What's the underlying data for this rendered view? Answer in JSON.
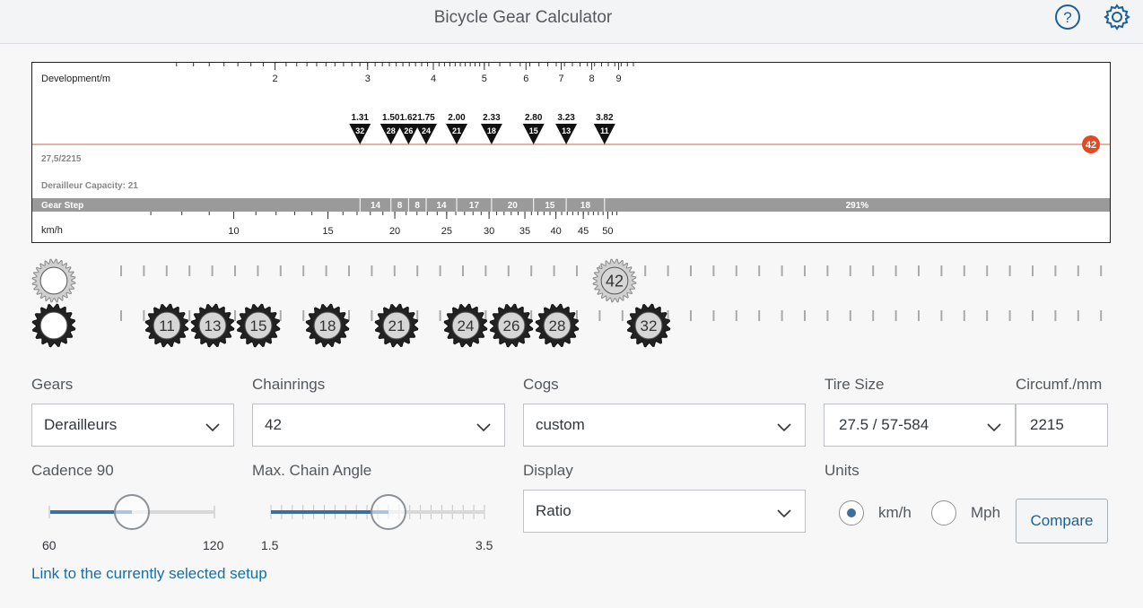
{
  "header": {
    "title": "Bicycle Gear Calculator",
    "help_icon": "help-circle-icon",
    "settings_icon": "gear-icon"
  },
  "chart_data": {
    "type": "gear-development-chart",
    "top_axis": {
      "label": "Development/m",
      "ticks": [
        "2",
        "3",
        "4",
        "5",
        "6",
        "7",
        "8",
        "9"
      ]
    },
    "bottom_axis": {
      "label": "km/h",
      "ticks": [
        "10",
        "15",
        "20",
        "25",
        "30",
        "35",
        "40",
        "45",
        "50"
      ]
    },
    "chainring_marker": "42",
    "setup_label": "27,5/2215",
    "capacity_label": "Derailleur Capacity: 21",
    "gear_step_label": "Gear Step",
    "ratios": [
      {
        "ratio": "1.31",
        "cog": "32"
      },
      {
        "ratio": "1.50",
        "cog": "28"
      },
      {
        "ratio": "1.62",
        "cog": "26"
      },
      {
        "ratio": "1.75",
        "cog": "24"
      },
      {
        "ratio": "2.00",
        "cog": "21"
      },
      {
        "ratio": "2.33",
        "cog": "18"
      },
      {
        "ratio": "2.80",
        "cog": "15"
      },
      {
        "ratio": "3.23",
        "cog": "13"
      },
      {
        "ratio": "3.82",
        "cog": "11"
      }
    ],
    "steps": [
      "14",
      "8",
      "8",
      "14",
      "17",
      "20",
      "15",
      "18",
      "291%"
    ],
    "colors": {
      "chainline": "#c8643c",
      "marker": "#e04a24",
      "stepbar": "#9a9a9a"
    }
  },
  "drivetrain": {
    "chainring": "42",
    "cogs": [
      "11",
      "13",
      "15",
      "18",
      "21",
      "24",
      "26",
      "28",
      "32"
    ]
  },
  "form": {
    "gears": {
      "label": "Gears",
      "value": "Derailleurs"
    },
    "chainrings": {
      "label": "Chainrings",
      "value": "42"
    },
    "cogs": {
      "label": "Cogs",
      "value": "custom"
    },
    "tire": {
      "label": "Tire Size",
      "value": "27.5 / 57-584"
    },
    "circ": {
      "label": "Circumf./mm",
      "value": "2215"
    },
    "cadence": {
      "label": "Cadence 90",
      "min": "60",
      "max": "120",
      "value": 90
    },
    "chain_angle": {
      "label": "Max. Chain Angle",
      "min": "1.5",
      "max": "3.5",
      "value": 2.5
    },
    "display": {
      "label": "Display",
      "value": "Ratio"
    },
    "units": {
      "label": "Units",
      "kmh": "km/h",
      "mph": "Mph",
      "selected": "km/h"
    },
    "compare_label": "Compare",
    "link_label": "Link to the currently selected setup"
  }
}
